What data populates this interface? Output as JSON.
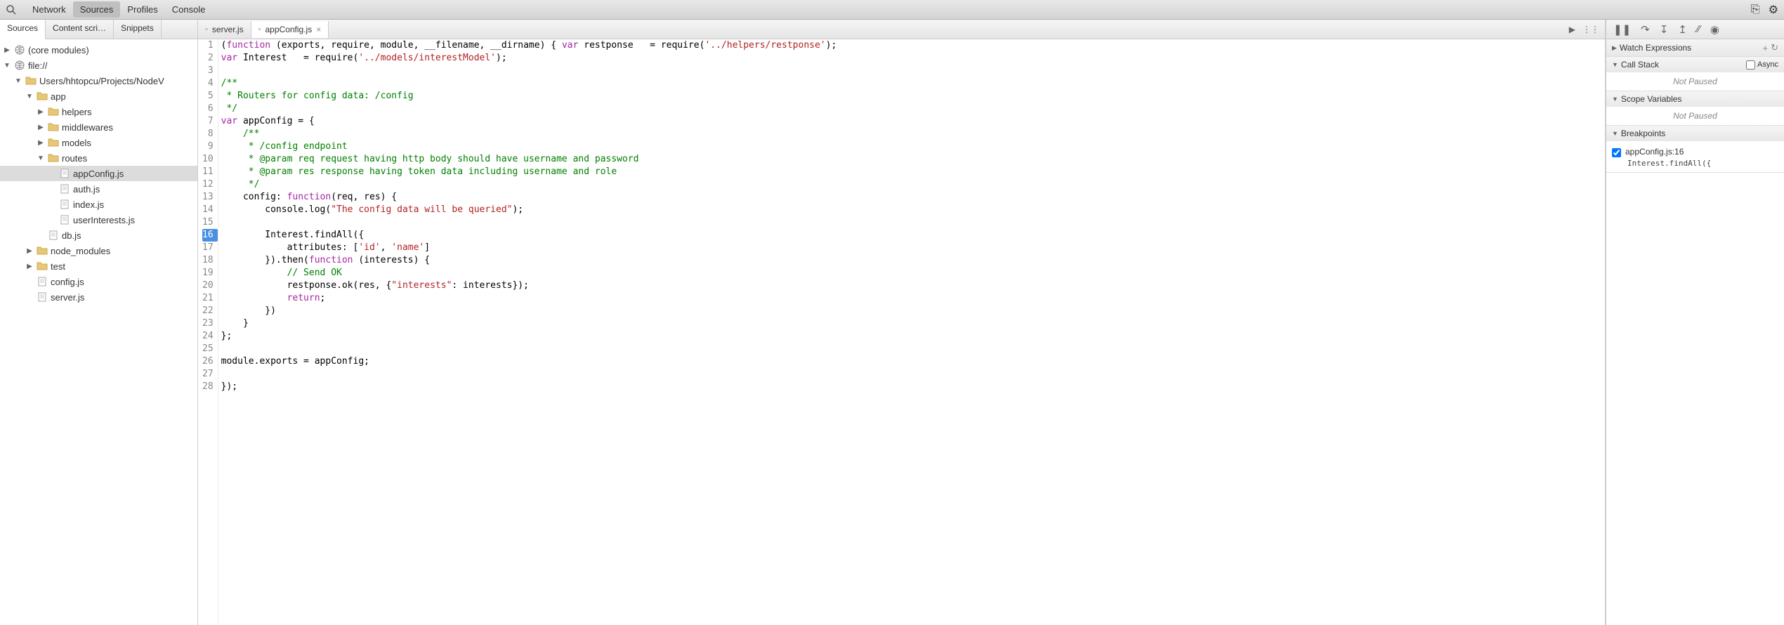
{
  "toolbar": {
    "tabs": [
      "Network",
      "Sources",
      "Profiles",
      "Console"
    ],
    "active_tab": "Sources"
  },
  "left_panel": {
    "tabs": [
      "Sources",
      "Content scri…",
      "Snippets"
    ],
    "active_tab": "Sources",
    "tree": [
      {
        "label": "(core modules)",
        "type": "globe",
        "indent": 0,
        "arrow": "▶"
      },
      {
        "label": "file://",
        "type": "globe",
        "indent": 0,
        "arrow": "▼"
      },
      {
        "label": "Users/hhtopcu/Projects/NodeV",
        "type": "folder",
        "indent": 1,
        "arrow": "▼"
      },
      {
        "label": "app",
        "type": "folder",
        "indent": 2,
        "arrow": "▼"
      },
      {
        "label": "helpers",
        "type": "folder",
        "indent": 3,
        "arrow": "▶"
      },
      {
        "label": "middlewares",
        "type": "folder",
        "indent": 3,
        "arrow": "▶"
      },
      {
        "label": "models",
        "type": "folder",
        "indent": 3,
        "arrow": "▶"
      },
      {
        "label": "routes",
        "type": "folder",
        "indent": 3,
        "arrow": "▼"
      },
      {
        "label": "appConfig.js",
        "type": "file",
        "indent": 4,
        "arrow": "",
        "selected": true
      },
      {
        "label": "auth.js",
        "type": "file",
        "indent": 4,
        "arrow": ""
      },
      {
        "label": "index.js",
        "type": "file",
        "indent": 4,
        "arrow": ""
      },
      {
        "label": "userInterests.js",
        "type": "file",
        "indent": 4,
        "arrow": ""
      },
      {
        "label": "db.js",
        "type": "file",
        "indent": 3,
        "arrow": ""
      },
      {
        "label": "node_modules",
        "type": "folder",
        "indent": 2,
        "arrow": "▶"
      },
      {
        "label": "test",
        "type": "folder",
        "indent": 2,
        "arrow": "▶"
      },
      {
        "label": "config.js",
        "type": "file",
        "indent": 2,
        "arrow": ""
      },
      {
        "label": "server.js",
        "type": "file",
        "indent": 2,
        "arrow": ""
      }
    ]
  },
  "editor": {
    "tabs": [
      {
        "name": "server.js",
        "active": false
      },
      {
        "name": "appConfig.js",
        "active": true
      }
    ],
    "breakpoint_line": 16,
    "code": [
      {
        "n": 1,
        "tokens": [
          {
            "t": "(",
            "c": ""
          },
          {
            "t": "function",
            "c": "kw"
          },
          {
            "t": " (exports, require, module, __filename, __dirname) { ",
            "c": ""
          },
          {
            "t": "var",
            "c": "kw"
          },
          {
            "t": " restponse   = require(",
            "c": ""
          },
          {
            "t": "'../helpers/restponse'",
            "c": "str"
          },
          {
            "t": ");",
            "c": ""
          }
        ]
      },
      {
        "n": 2,
        "tokens": [
          {
            "t": "var",
            "c": "kw"
          },
          {
            "t": " Interest   = require(",
            "c": ""
          },
          {
            "t": "'../models/interestModel'",
            "c": "str"
          },
          {
            "t": ");",
            "c": ""
          }
        ]
      },
      {
        "n": 3,
        "tokens": []
      },
      {
        "n": 4,
        "tokens": [
          {
            "t": "/**",
            "c": "cmt"
          }
        ]
      },
      {
        "n": 5,
        "tokens": [
          {
            "t": " * Routers for config data: /config",
            "c": "cmt"
          }
        ]
      },
      {
        "n": 6,
        "tokens": [
          {
            "t": " */",
            "c": "cmt"
          }
        ]
      },
      {
        "n": 7,
        "tokens": [
          {
            "t": "var",
            "c": "kw"
          },
          {
            "t": " appConfig = {",
            "c": ""
          }
        ]
      },
      {
        "n": 8,
        "tokens": [
          {
            "t": "    ",
            "c": ""
          },
          {
            "t": "/**",
            "c": "cmt"
          }
        ]
      },
      {
        "n": 9,
        "tokens": [
          {
            "t": "     * /config endpoint",
            "c": "cmt"
          }
        ]
      },
      {
        "n": 10,
        "tokens": [
          {
            "t": "     * @param req request having http body should have username and password",
            "c": "cmt"
          }
        ]
      },
      {
        "n": 11,
        "tokens": [
          {
            "t": "     * @param res response having token data including username and role",
            "c": "cmt"
          }
        ]
      },
      {
        "n": 12,
        "tokens": [
          {
            "t": "     */",
            "c": "cmt"
          }
        ]
      },
      {
        "n": 13,
        "tokens": [
          {
            "t": "    config: ",
            "c": ""
          },
          {
            "t": "function",
            "c": "kw"
          },
          {
            "t": "(req, res) {",
            "c": ""
          }
        ]
      },
      {
        "n": 14,
        "tokens": [
          {
            "t": "        console.log(",
            "c": ""
          },
          {
            "t": "\"The config data will be queried\"",
            "c": "str"
          },
          {
            "t": ");",
            "c": ""
          }
        ]
      },
      {
        "n": 15,
        "tokens": []
      },
      {
        "n": 16,
        "tokens": [
          {
            "t": "        Interest.findAll({",
            "c": ""
          }
        ]
      },
      {
        "n": 17,
        "tokens": [
          {
            "t": "            attributes: [",
            "c": ""
          },
          {
            "t": "'id'",
            "c": "str"
          },
          {
            "t": ", ",
            "c": ""
          },
          {
            "t": "'name'",
            "c": "str"
          },
          {
            "t": "]",
            "c": ""
          }
        ]
      },
      {
        "n": 18,
        "tokens": [
          {
            "t": "        }).then(",
            "c": ""
          },
          {
            "t": "function",
            "c": "kw"
          },
          {
            "t": " (interests) {",
            "c": ""
          }
        ]
      },
      {
        "n": 19,
        "tokens": [
          {
            "t": "            ",
            "c": ""
          },
          {
            "t": "// Send OK",
            "c": "cmt"
          }
        ]
      },
      {
        "n": 20,
        "tokens": [
          {
            "t": "            restponse.ok(res, {",
            "c": ""
          },
          {
            "t": "\"interests\"",
            "c": "str"
          },
          {
            "t": ": interests});",
            "c": ""
          }
        ]
      },
      {
        "n": 21,
        "tokens": [
          {
            "t": "            ",
            "c": ""
          },
          {
            "t": "return",
            "c": "kw"
          },
          {
            "t": ";",
            "c": ""
          }
        ]
      },
      {
        "n": 22,
        "tokens": [
          {
            "t": "        })",
            "c": ""
          }
        ]
      },
      {
        "n": 23,
        "tokens": [
          {
            "t": "    }",
            "c": ""
          }
        ]
      },
      {
        "n": 24,
        "tokens": [
          {
            "t": "};",
            "c": ""
          }
        ]
      },
      {
        "n": 25,
        "tokens": []
      },
      {
        "n": 26,
        "tokens": [
          {
            "t": "module.exports = appConfig;",
            "c": ""
          }
        ]
      },
      {
        "n": 27,
        "tokens": []
      },
      {
        "n": 28,
        "tokens": [
          {
            "t": "});",
            "c": ""
          }
        ]
      }
    ]
  },
  "right_panel": {
    "watch": {
      "title": "Watch Expressions"
    },
    "callstack": {
      "title": "Call Stack",
      "status": "Not Paused",
      "async_label": "Async"
    },
    "scope": {
      "title": "Scope Variables",
      "status": "Not Paused"
    },
    "breakpoints": {
      "title": "Breakpoints",
      "items": [
        {
          "label": "appConfig.js:16",
          "snippet": "Interest.findAll({",
          "checked": true
        }
      ]
    }
  }
}
